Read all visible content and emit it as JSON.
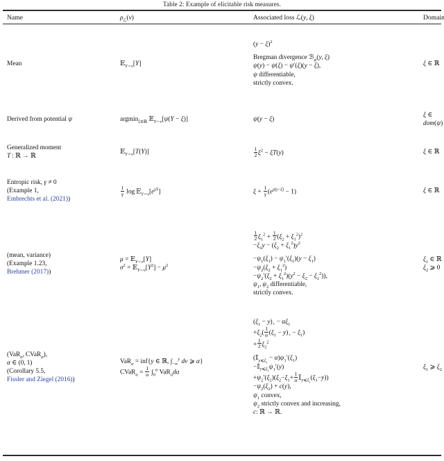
{
  "caption": "Table 2: Example of elicitable risk measures.",
  "header": {
    "name": "Name",
    "rho": "ρℒ(ν)",
    "loss": "Associated loss ℒ(y, ξ)",
    "domain": "Domain"
  },
  "colors": {
    "text": "#111111",
    "rule": "#2b2b2b",
    "citation_link": "#2a3fa0",
    "background": "#ffffff"
  },
  "rows": [
    {
      "id": "mean",
      "name": "Mean",
      "name_lines": [
        "Mean"
      ],
      "rho": "𝔼_{Y~ν}[Y]",
      "loss_lines": [
        "(y − ξ)²",
        "",
        "Bregman divergence ℬ_ψ(y, ξ)",
        "ψ(y) − ψ(ξ) − ψ′(ξ)(y − ξ),",
        "ψ differentiable,",
        "strictly convex."
      ],
      "domain": "ξ ∈ ℝ"
    },
    {
      "id": "potential",
      "name": "Derived from potential ψ",
      "name_lines": [
        "Derived from potential ψ"
      ],
      "rho": "argmin_{ξ∈ℝ} 𝔼_{Y~ν}[ψ(Y − ξ)]",
      "loss_lines": [
        "ψ(y − ξ)"
      ],
      "domain": "ξ ∈ dom(ψ)"
    },
    {
      "id": "generalized-moment",
      "name": "Generalized moment T: ℝ → ℝ",
      "name_lines": [
        "Generalized moment",
        "T : ℝ → ℝ"
      ],
      "rho": "𝔼_{Y~ν}[T(Y)]",
      "loss_lines": [
        "½ξ² − ξT(y)"
      ],
      "domain": "ξ ∈ ℝ"
    },
    {
      "id": "entropic-risk",
      "name": "Entropic risk, γ ≠ 0 (Example 1, Embrechts et al. (2021))",
      "name_lines": [
        "Entropic risk, γ ≠ 0",
        "(Example 1,",
        "Embrechts et al. (2021))"
      ],
      "citation": "Embrechts et al. (2021)",
      "rho": "(1/γ) log 𝔼_{Y~ν}[e^{γY}]",
      "loss_lines": [
        "ξ + (1/γ)(e^{γ(y−ξ)} − 1)"
      ],
      "domain": "ξ ∈ ℝ"
    },
    {
      "id": "mean-variance",
      "name": "(mean, variance) (Example 1.23, Brehmer (2017))",
      "name_lines": [
        "(mean, variance)",
        "(Example 1.23,",
        "Brehmer (2017))"
      ],
      "citation": "Brehmer (2017)",
      "rho_lines": [
        "μ = 𝔼_{Y~ν}[Y]",
        "σ² = 𝔼_{Y~ν}[Y²] − μ²"
      ],
      "loss_lines": [
        "½ξ₁² + ½(ξ₂ + ξ₁²)²",
        "−ξ₁y − (ξ₂ + ξ₁²)y²",
        "",
        "−ψ₁(ξ₁) − ψ₁′(ξ₁)(y − ξ₁)",
        "−ψ₂(ξ₂ + ξ₁²)",
        "−ψ₂′(ξ₂ + ξ₁²)(y² − ξ₂ − ξ₁²)),",
        "ψ₁, ψ₂ differentiable,",
        "strictly convex."
      ],
      "domain_lines": [
        "ξ₁ ∈ ℝ",
        "ξ₂ ⩾ 0"
      ]
    },
    {
      "id": "var-cvar",
      "name": "(VaRα, CVaRα), α ∈ (0, 1) (Corollary 5.5, Fissler and Ziegel (2016))",
      "name_lines": [
        "(VaRα, CVaRα),",
        "α ∈ (0, 1)",
        "(Corollary 5.5,",
        "Fissler and Ziegel (2016))"
      ],
      "citation": "Fissler and Ziegel (2016)",
      "rho_lines": [
        "VaRα = inf{y ∈ ℝ, ∫_{−∞}^{y} dν ⩾ α}",
        "CVaRα = (1/α) ∫₀^α VaR_a da"
      ],
      "loss_lines": [
        "(ξ₁ − y)₊ − αξ₁",
        "+ξ₂((1/α)(ξ₁ − y)₊ − ξ₁)",
        "+½ξ₂²",
        "",
        "(𝕀_{y⩽ξ₁} − α)ψ₁′(ξ₁)",
        "−𝕀_{y⩽ξ₁}ψ₁′(y)",
        "+ψ₂′(ξ₂)(ξ₂ − ξ₁ + (1/α)𝕀_{y⩽ξ₁}(ξ₁ − y))",
        "−ψ₂(ξ₂) + c(y),",
        "ψ₁ convex,",
        "ψ₂ strictly convex and increasing,",
        "c: ℝ → ℝ."
      ],
      "domain": "ξ₁ ⩾ ξ₂"
    }
  ]
}
